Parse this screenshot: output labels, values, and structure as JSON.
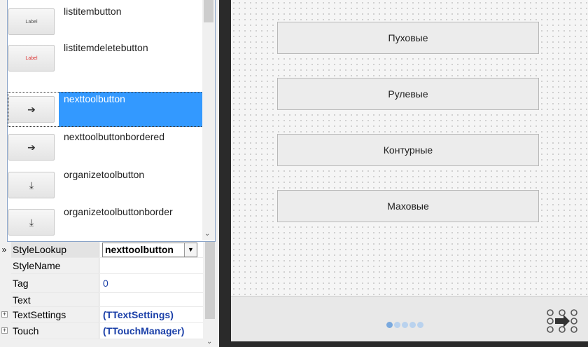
{
  "style_dropdown": {
    "items": [
      {
        "label": "listitembutton",
        "thumb": "Label",
        "thumb_color": "#555555"
      },
      {
        "label": "listitemdeletebutton",
        "thumb": "Label",
        "thumb_color": "#dd3333"
      },
      {
        "label": "nexttoolbutton",
        "thumb": "➔",
        "selected": true
      },
      {
        "label": "nexttoolbuttonbordered",
        "thumb": "➔"
      },
      {
        "label": "organizetoolbutton",
        "thumb": "⤓"
      },
      {
        "label": "organizetoolbuttonborder",
        "thumb": "⤓"
      }
    ]
  },
  "properties": {
    "active_marker": "»",
    "rows": [
      {
        "name": "StyleLookup",
        "value": "nexttoolbutton",
        "kind": "combo",
        "active": true
      },
      {
        "name": "StyleName",
        "value": ""
      },
      {
        "name": "Tag",
        "value": "0"
      },
      {
        "name": "Text",
        "value": ""
      },
      {
        "name": "TextSettings",
        "value": "(TTextSettings)",
        "expandable": true
      },
      {
        "name": "Touch",
        "value": "(TTouchManager)",
        "expandable": true
      }
    ]
  },
  "canvas": {
    "buttons": [
      "Пуховые",
      "Рулевые",
      "Контурные",
      "Маховые"
    ],
    "page_indicator": {
      "count": 5,
      "active": 0
    }
  },
  "colors": {
    "selection": "#3399ff",
    "value_blue": "#1a3fa8",
    "dot": "#b9d2ee",
    "dot_active": "#7aa9de"
  }
}
